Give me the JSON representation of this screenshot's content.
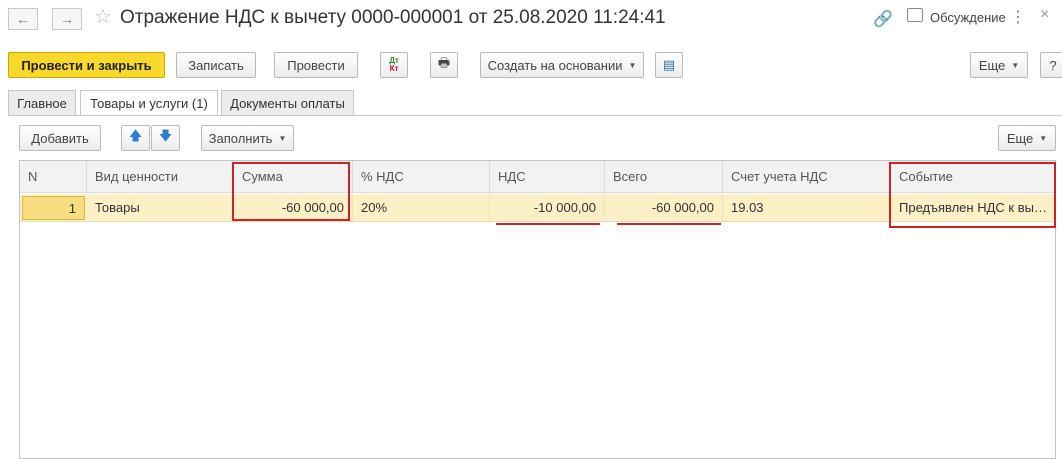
{
  "window": {
    "title": "Отражение НДС к вычету 0000-000001 от 25.08.2020 11:24:41",
    "discussion_label": "Обсуждение",
    "back_glyph": "←",
    "forward_glyph": "→",
    "star_glyph": "☆",
    "link_glyph": "🔗",
    "kebab_glyph": "⋮",
    "close_glyph": "×"
  },
  "toolbar": {
    "post_and_close": "Провести и закрыть",
    "save": "Записать",
    "post": "Провести",
    "dt_label": "Дт",
    "kt_label": "Кт",
    "print_glyph": "🖶",
    "create_based_on": "Создать на основании",
    "structure_glyph": "▤",
    "more": "Еще",
    "help": "?"
  },
  "tabs": [
    {
      "label": "Главное",
      "active": false
    },
    {
      "label": "Товары и услуги (1)",
      "active": true
    },
    {
      "label": "Документы оплаты",
      "active": false
    }
  ],
  "table_toolbar": {
    "add": "Добавить",
    "up_glyph": "🡅",
    "down_glyph": "🡇",
    "fill": "Заполнить",
    "more": "Еще"
  },
  "table": {
    "columns": [
      "N",
      "Вид ценности",
      "Сумма",
      "% НДС",
      "НДС",
      "Всего",
      "Счет учета НДС",
      "Событие"
    ],
    "rows": [
      {
        "n": "1",
        "kind": "Товары",
        "sum": "-60 000,00",
        "vat_rate": "20%",
        "vat": "-10 000,00",
        "total": "-60 000,00",
        "vat_account": "19.03",
        "event": "Предъявлен НДС к вычету"
      }
    ]
  },
  "colors": {
    "primary_button": "#f7d82b",
    "selected_row": "#fbf0c6",
    "annotation_red": "#d0202a"
  }
}
